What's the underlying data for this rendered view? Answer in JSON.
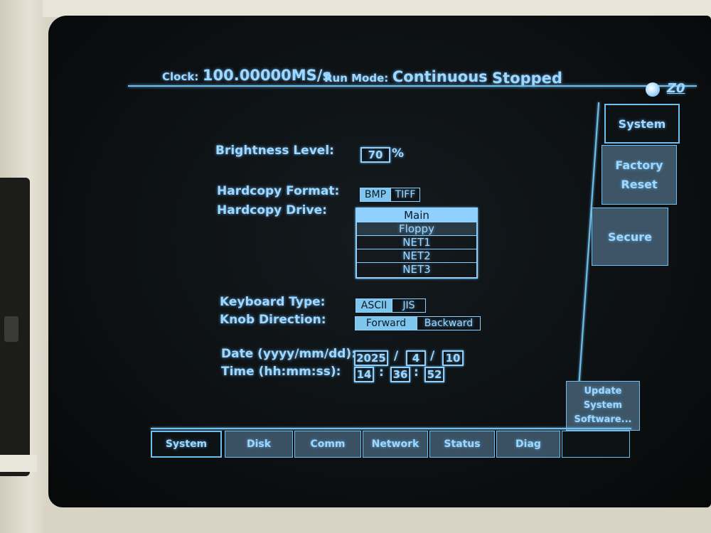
{
  "status_bar": {
    "clock_label": "Clock:",
    "clock_value": "100.00000MS/s",
    "run_mode_label": "Run Mode:",
    "run_mode_value": "Continuous",
    "run_state": "Stopped",
    "knob_label": "Z0",
    "knob_icon": "knob-icon"
  },
  "settings": {
    "brightness_label": "Brightness Level:",
    "brightness_value": "70",
    "brightness_unit": "%",
    "hardcopy_format_label": "Hardcopy Format:",
    "hardcopy_format_options": [
      "BMP",
      "TIFF"
    ],
    "hardcopy_format_selected": "BMP",
    "hardcopy_drive_label": "Hardcopy Drive:",
    "hardcopy_drive_options": [
      "Main",
      "Floppy",
      "NET1",
      "NET2",
      "NET3"
    ],
    "hardcopy_drive_selected": "Main",
    "keyboard_type_label": "Keyboard Type:",
    "keyboard_type_options": [
      "ASCII",
      "JIS"
    ],
    "keyboard_type_selected": "ASCII",
    "knob_direction_label": "Knob Direction:",
    "knob_direction_options": [
      "Forward",
      "Backward"
    ],
    "knob_direction_selected": "Forward",
    "date_label": "Date (yyyy/mm/dd):",
    "date_year": "2025",
    "date_month": "4",
    "date_day": "10",
    "date_separator": "/",
    "time_label": "Time (hh:mm:ss):",
    "time_hour": "14",
    "time_minute": "36",
    "time_second": "52",
    "time_separator": ":"
  },
  "softkeys": {
    "system": "System",
    "factory_reset_line1": "Factory",
    "factory_reset_line2": "Reset",
    "secure": "Secure",
    "update_line1": "Update",
    "update_line2": "System",
    "update_line3": "Software..."
  },
  "tabs": [
    {
      "label": "System",
      "active": true
    },
    {
      "label": "Disk"
    },
    {
      "label": "Comm"
    },
    {
      "label": "Network"
    },
    {
      "label": "Status"
    },
    {
      "label": "Diag"
    }
  ],
  "colors": {
    "phosphor": "#9fd8ff",
    "highlight": "#7ec6ee",
    "background": "#0c1012"
  }
}
